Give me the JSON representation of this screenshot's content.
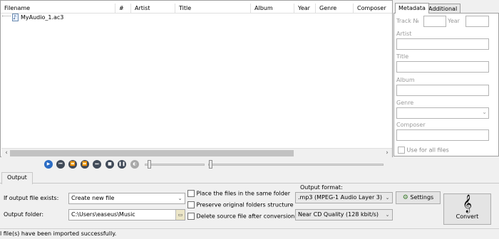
{
  "file_list": {
    "columns": [
      "Filename",
      "#",
      "Artist",
      "Title",
      "Album",
      "Year",
      "Genre",
      "Composer"
    ],
    "files": [
      {
        "name": "MyAudio_1.ac3"
      }
    ]
  },
  "metadata_panel": {
    "tabs": [
      "Metadata",
      "Additional"
    ],
    "labels": {
      "track": "Track №",
      "year": "Year",
      "artist": "Artist",
      "title": "Title",
      "album": "Album",
      "genre": "Genre",
      "composer": "Composer"
    },
    "use_for_all": "Use for all files"
  },
  "output": {
    "tab_label": "Output",
    "if_exists_label": "If output file exists:",
    "if_exists_value": "Create new file",
    "folder_label": "Output folder:",
    "folder_value": "C:\\Users\\easeus\\Music",
    "options": [
      "Place the files in the same folder",
      "Preserve original folders structure",
      "Delete source file after conversion"
    ],
    "format_label": "Output format:",
    "format_value": ".mp3 (MPEG-1 Audio Layer 3)",
    "quality_value": "Near CD Quality (128 kbit/s)",
    "settings_label": "Settings",
    "convert_label": "Convert"
  },
  "status": {
    "text": "l file(s) have been imported successfully."
  }
}
